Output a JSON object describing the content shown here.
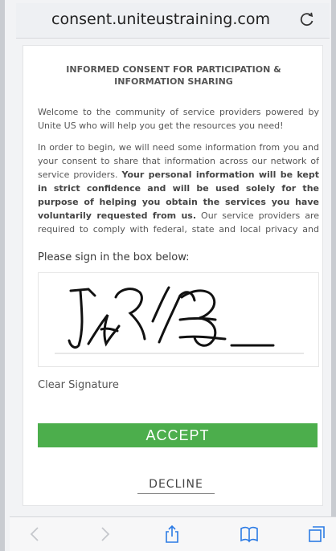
{
  "browser": {
    "url": "consent.uniteustraining.com",
    "reload_icon": "reload-icon",
    "toolbar_icons": [
      "back-icon",
      "forward-icon",
      "share-icon",
      "bookmarks-icon",
      "tabs-icon"
    ]
  },
  "consent": {
    "title_line1": "INFORMED CONSENT FOR PARTICIPATION &",
    "title_line2": "INFORMATION SHARING",
    "para1": "Welcome to the community of service providers powered by Unite US who will help you get the resources you need!",
    "para2_start": "In order to begin, we will need some information from you and your consent to share that information across our network of service providers.",
    "para2_bold": "Your personal information will be kept in strict confidence and will be used solely for the purpose of helping you obtain the services you have voluntarily requested from us.",
    "para2_end": "Our service providers are required to comply with federal, state and local privacy and data protection"
  },
  "signature": {
    "label": "Please sign in the box below:",
    "clear_label": "Clear Signature"
  },
  "actions": {
    "accept_label": "ACCEPT",
    "decline_label": "DECLINE"
  },
  "colors": {
    "accept": "#4cae4c"
  }
}
